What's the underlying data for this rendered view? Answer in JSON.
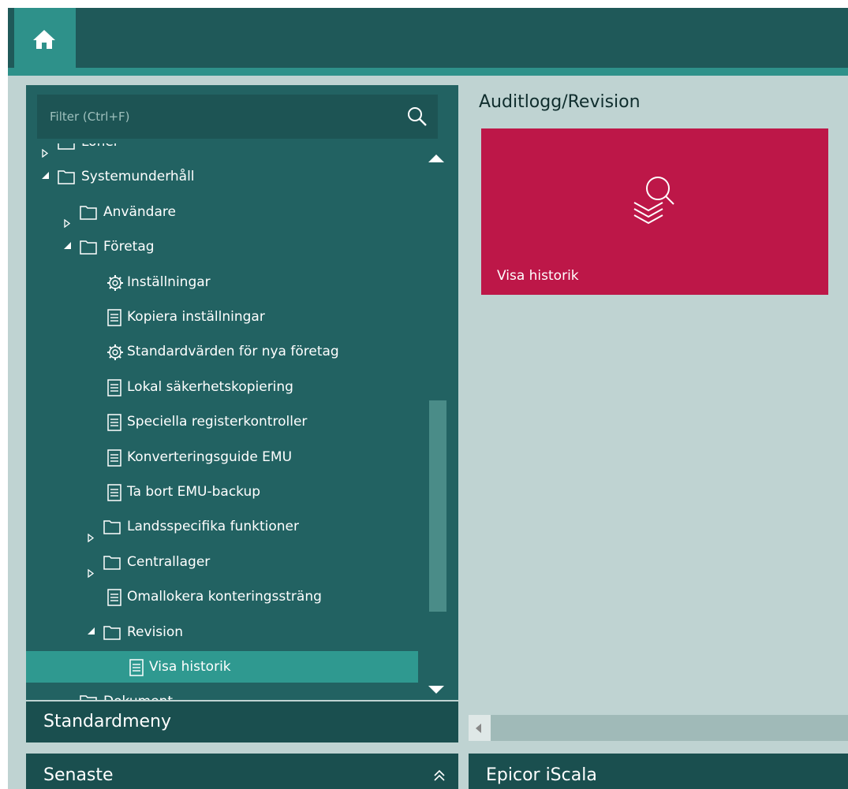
{
  "filter": {
    "placeholder": "Filter (Ctrl+F)"
  },
  "tree": [
    {
      "label": "Löner",
      "type": "folder",
      "expanded": false,
      "level": 0
    },
    {
      "label": "Systemunderhåll",
      "type": "folder",
      "expanded": true,
      "level": 0
    },
    {
      "label": "Användare",
      "type": "folder",
      "expanded": false,
      "level": 1
    },
    {
      "label": "Företag",
      "type": "folder",
      "expanded": true,
      "level": 1
    },
    {
      "label": "Inställningar",
      "type": "settings",
      "level": 2
    },
    {
      "label": "Kopiera inställningar",
      "type": "document",
      "level": 2
    },
    {
      "label": "Standardvärden för nya företag",
      "type": "settings",
      "level": 2
    },
    {
      "label": "Lokal säkerhetskopiering",
      "type": "document",
      "level": 2
    },
    {
      "label": "Speciella registerkontroller",
      "type": "document",
      "level": 2
    },
    {
      "label": "Konverteringsguide EMU",
      "type": "document",
      "level": 2
    },
    {
      "label": "Ta bort EMU-backup",
      "type": "document",
      "level": 2
    },
    {
      "label": "Landsspecifika funktioner",
      "type": "folder",
      "expanded": false,
      "level": 2
    },
    {
      "label": "Centrallager",
      "type": "folder",
      "expanded": false,
      "level": 2
    },
    {
      "label": "Omallokera konteringssträng",
      "type": "document",
      "level": 2
    },
    {
      "label": "Revision",
      "type": "folder",
      "expanded": true,
      "level": 2
    },
    {
      "label": "Visa historik",
      "type": "document",
      "level": 3,
      "selected": true
    },
    {
      "label": "Dokument",
      "type": "folder",
      "expanded": false,
      "level": 1
    }
  ],
  "left": {
    "standard_menu": "Standardmeny",
    "recent": "Senaste"
  },
  "content": {
    "title": "Auditlogg/Revision",
    "tile_label": "Visa historik",
    "tile_color": "#bd1748"
  },
  "footer": {
    "app_name": "Epicor iScala"
  },
  "icons": {
    "home": "home-icon",
    "search": "search-icon",
    "folder": "folder-icon",
    "document": "document-icon",
    "settings": "gear-icon",
    "tile": "search-layers-icon",
    "chevron": "double-chevron-up-icon"
  },
  "colors": {
    "topbar": "#1f5959",
    "accent": "#2e918a",
    "panel": "#226262",
    "background": "#bfd3d2",
    "selected_row": "#2f9990"
  }
}
